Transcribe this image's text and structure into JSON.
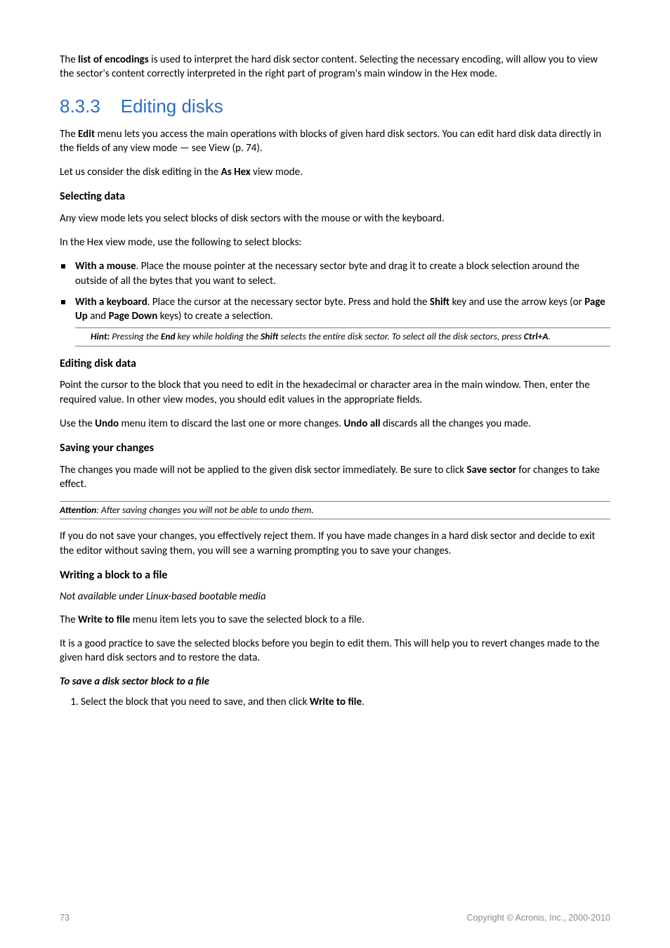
{
  "intro_para": "The <b>list of encodings</b> is used to interpret the hard disk sector content. Selecting the necessary encoding, will allow you to view the sector's content correctly interpreted in the right part of program's main window in the Hex mode.",
  "section_number": "8.3.3",
  "section_title": "Editing disks",
  "p1": "The <b>Edit</b> menu lets you access the main operations with blocks of given hard disk sectors. You can edit hard disk data directly in the fields of any view mode — see View (p. 74).",
  "p2": "Let us consider the disk editing in the <b>As Hex</b> view mode.",
  "selecting_heading": "Selecting data",
  "p3": "Any view mode lets you select blocks of disk sectors with the mouse or with the keyboard.",
  "p4": "In the Hex view mode, use the following to select blocks:",
  "bullet1": "<b>With a mouse</b>. Place the mouse pointer at the necessary sector byte and drag it to create a block selection around the outside of all the bytes that you want to select.",
  "bullet2": "<b>With a keyboard</b>. Place the cursor at the necessary sector byte. Press and hold the <b>Shift</b> key and use the arrow keys (or <b>Page Up</b> and <b>Page Down</b> keys) to create a selection.",
  "hint": "<b>Hint:</b> Pressing the <b>End</b> key while holding the <b>Shift</b> selects the entire disk sector. To select all the disk sectors, press <b>Ctrl+A</b>.",
  "editing_heading": "Editing disk data",
  "p5": "Point the cursor to the block that you need to edit in the hexadecimal or character area in the main window. Then, enter the required value. In other view modes, you should edit values in the appropriate fields.",
  "p6": "Use the <b>Undo</b> menu item to discard the last one or more changes. <b>Undo all</b> discards all the changes you made.",
  "saving_heading": "Saving your changes",
  "p7": "The changes you made will not be applied to the given disk sector immediately. Be sure to click <b>Save sector</b> for changes to take effect.",
  "attention": "<b>Attention</b>: After saving changes you will not be able to undo them.",
  "p8": "If you do not save your changes, you effectively reject them. If you have made changes in a hard disk sector and decide to exit the editor without saving them, you will see a warning prompting you to save your changes.",
  "writing_heading": "Writing a block to a file",
  "note": "Not available under Linux-based bootable media",
  "p9": "The <b>Write to file</b> menu item lets you to save the selected block to a file.",
  "p10": "It is a good practice to save the selected blocks before you begin to edit them. This will help you to revert changes made to the given hard disk sectors and to restore the data.",
  "tosave_heading": "To save a disk sector block to a file",
  "step1": "Select the block that you need to save, and then click <b>Write to file</b>.",
  "footer_page": "73",
  "footer_copyright": "Copyright © Acronis, Inc., 2000-2010"
}
